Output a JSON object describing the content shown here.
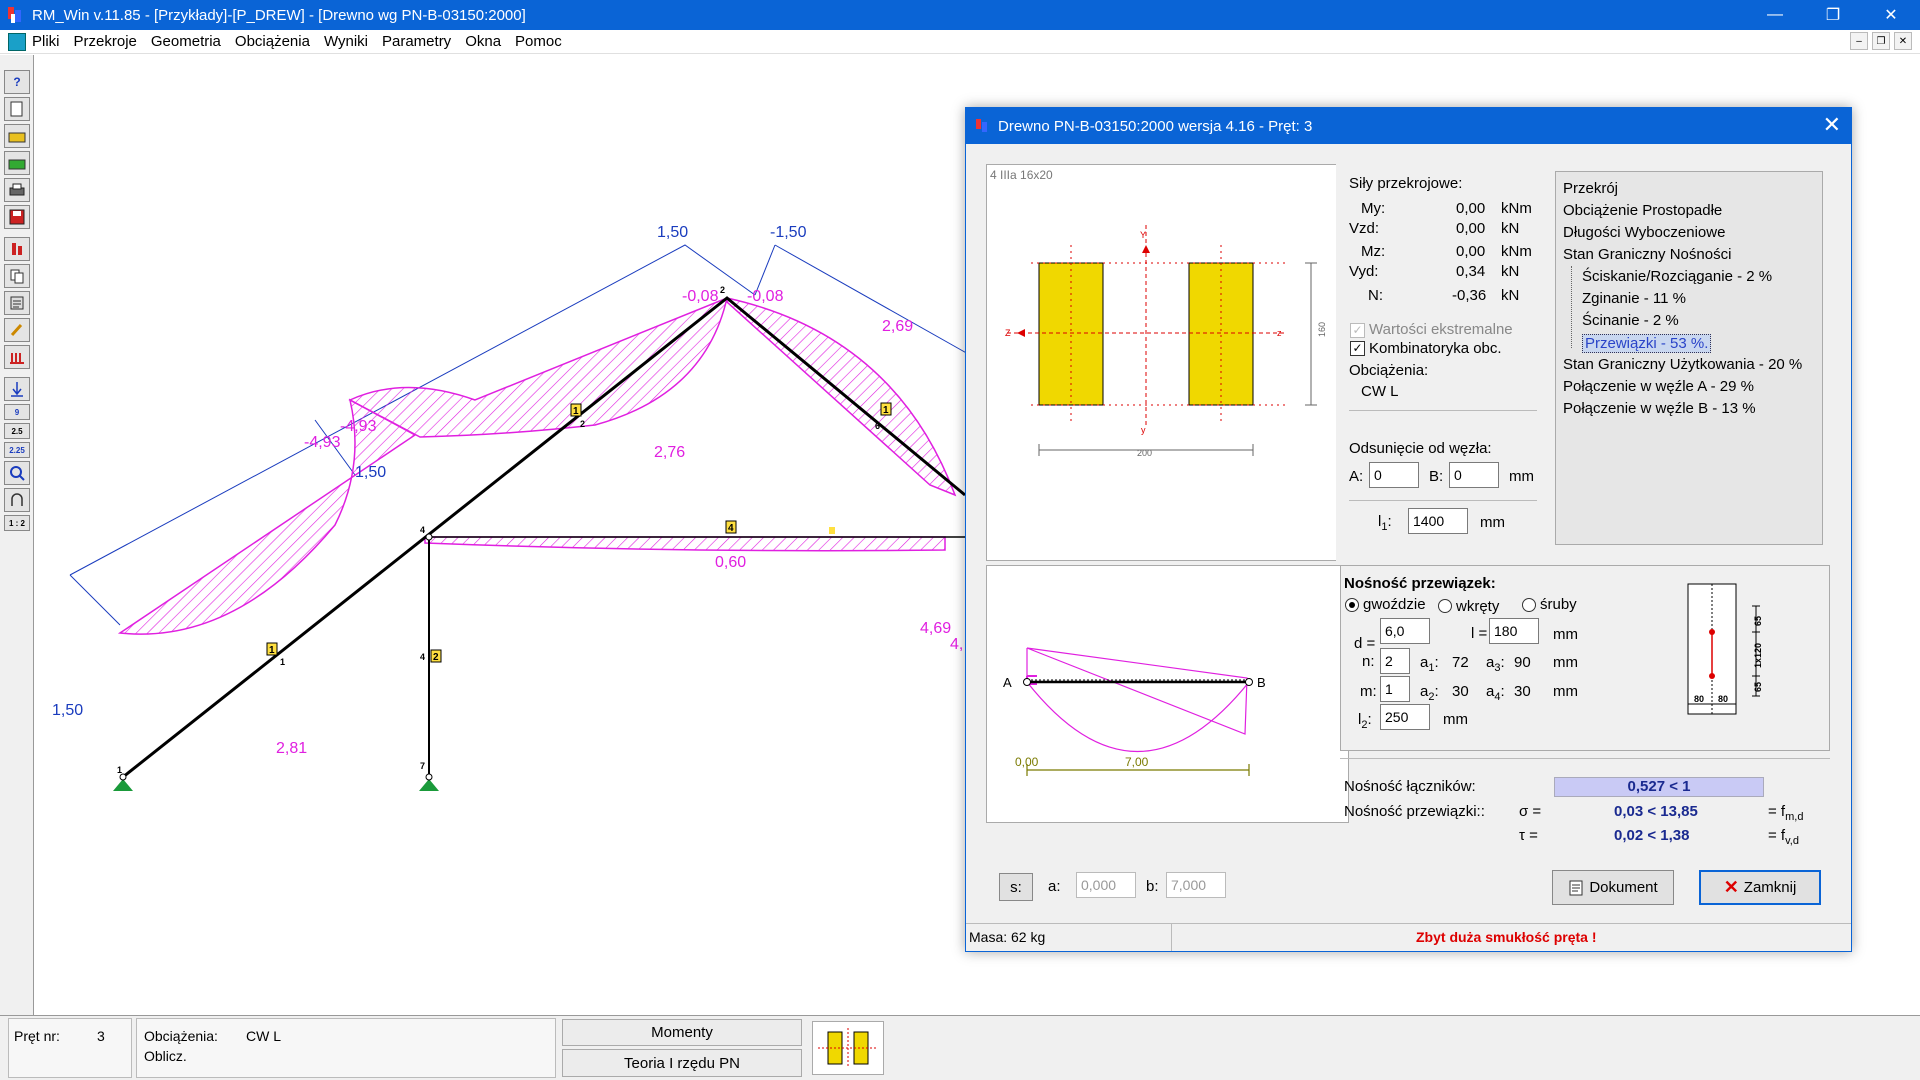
{
  "window": {
    "title": "RM_Win v.11.85 - [Przykłady]-[P_DREW] - [Drewno wg PN-B-03150:2000]",
    "minimize": "—",
    "maximize": "❐",
    "close": "✕"
  },
  "menu": {
    "items": [
      "Pliki",
      "Przekroje",
      "Geometria",
      "Obciążenia",
      "Wyniki",
      "Parametry",
      "Okna",
      "Pomoc"
    ],
    "mdi_min": "–",
    "mdi_restore": "❐",
    "mdi_close": "✕"
  },
  "toolbar": {
    "help": "?",
    "nine": "9",
    "dim_25": "2.5",
    "dim_225": "2.25",
    "ratio": "1 : 2"
  },
  "diagram": {
    "labels_blue": [
      "1,50",
      "-1,50",
      "1,50",
      "1,50"
    ],
    "labels_magenta": [
      "-0,08",
      "-0,08",
      "2,69",
      "-4,93",
      "-4,93",
      "2,76",
      "0,60",
      "2,81",
      "4,69",
      "4,"
    ],
    "bar_labels": [
      "1",
      "1",
      "1",
      "2",
      "4"
    ],
    "node_labels": [
      "1",
      "2",
      "4",
      "6",
      "7",
      "1",
      "2",
      "4"
    ]
  },
  "status": {
    "bar_no_label": "Pręt nr:",
    "bar_no": "3",
    "loads_label": "Obciążenia:",
    "loads_value": "CW L",
    "calc_label": "Oblicz.",
    "moments_btn": "Momenty",
    "theory_btn": "Teoria I rzędu PN"
  },
  "dialog": {
    "title": "Drewno PN-B-03150:2000 wersja 4.16 - Pręt: 3",
    "close": "✕",
    "section": {
      "caption": "4 IIIa 16x20",
      "dim_width": "200",
      "dim_height": "160",
      "axis_y": "Y",
      "axis_z": "Z",
      "axis_y2": "y",
      "axis_z2": "z"
    },
    "forces": {
      "heading": "Siły przekrojowe:",
      "rows": [
        {
          "label": "My:",
          "value": "0,00",
          "unit": "kNm"
        },
        {
          "label": "Vzd:",
          "value": "0,00",
          "unit": "kN"
        },
        {
          "label": "Mz:",
          "value": "0,00",
          "unit": "kNm"
        },
        {
          "label": "Vyd:",
          "value": "0,34",
          "unit": "kN"
        },
        {
          "label": "N:",
          "value": "-0,36",
          "unit": "kN"
        }
      ],
      "extreme": "Wartości ekstremalne",
      "combinatorics": "Kombinatoryka obc.",
      "loads_label": "Obciążenia:",
      "loads_value": "CW L",
      "offset_label": "Odsunięcie od węzła:",
      "a_label": "A:",
      "a_value": "0",
      "b_label": "B:",
      "b_value": "0",
      "offset_unit": "mm",
      "l1_label": "l",
      "l1_sub": "1",
      "l1_colon": ":",
      "l1_value": "1400",
      "l1_unit": "mm"
    },
    "tree": [
      {
        "text": "Przekrój",
        "level": 1
      },
      {
        "text": "Obciążenie Prostopadłe",
        "level": 1
      },
      {
        "text": "Długości Wyboczeniowe",
        "level": 1
      },
      {
        "text": "Stan Graniczny Nośności",
        "level": 1
      },
      {
        "text": "Ściskanie/Rozciąganie - 2 %",
        "level": 2
      },
      {
        "text": "Zginanie - 11 %",
        "level": 2
      },
      {
        "text": "Ścinanie - 2 %",
        "level": 2
      },
      {
        "text": "Przewiązki - 53 %.",
        "level": 2,
        "selected": true
      },
      {
        "text": "Stan Graniczny Użytkowania - 20 %",
        "level": 1
      },
      {
        "text": "Połączenie w węźle A - 29 %",
        "level": 1
      },
      {
        "text": "Połączenie w węźle B - 13 %",
        "level": 1
      }
    ],
    "beam": {
      "left_node": "A",
      "right_node": "B",
      "dim_start": "0,00",
      "dim_len": "7,00"
    },
    "connectors": {
      "heading": "Nośność przewiązek:",
      "type_nails": "gwoździe",
      "type_screws": "wkręty",
      "type_bolts": "śruby",
      "d_label": "d =",
      "d_value": "6,0",
      "l_label": "l =",
      "l_value": "180",
      "unit": "mm",
      "n_label": "n:",
      "n_value": "2",
      "a1_label": "a",
      "a1_sub": "1",
      "a1_value": "72",
      "a3_label": "a",
      "a3_sub": "3",
      "a3_value": "90",
      "m_label": "m:",
      "m_value": "1",
      "a2_label": "a",
      "a2_sub": "2",
      "a2_value": "30",
      "a4_label": "a",
      "a4_sub": "4",
      "a4_value": "30",
      "l2_label": "l",
      "l2_sub": "2",
      "l2_value": "250",
      "sketch_dim_top": "65",
      "sketch_dim_mid": "1x120",
      "sketch_dim_bot": "65",
      "sketch_w1": "80",
      "sketch_w2": "80"
    },
    "capacity": {
      "fasteners_label": "Nośność łączników:",
      "fasteners_value": "0,527 < 1",
      "tie_label": "Nośność przewiązki::",
      "sigma_label": "σ =",
      "sigma_value": "0,03 < 13,85",
      "sigma_f": "= f",
      "sigma_sub": "m,d",
      "tau_label": "τ =",
      "tau_value": "0,02 < 1,38",
      "tau_f": "= f",
      "tau_sub": "v,d"
    },
    "bottom": {
      "s_btn": "s:",
      "a_label": "a:",
      "a_value": "0,000",
      "b_label": "b:",
      "b_value": "7,000",
      "doc_btn": "Dokument",
      "close_btn": "Zamknij",
      "mass": "Masa: 62 kg",
      "warning": "Zbyt duża smukłość pręta !"
    }
  }
}
